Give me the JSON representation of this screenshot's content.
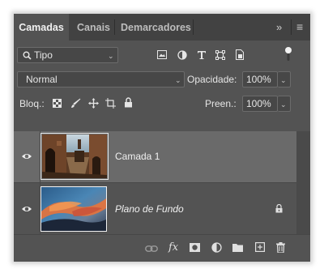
{
  "tabs": [
    {
      "label": "Camadas",
      "active": true
    },
    {
      "label": "Canais",
      "active": false
    },
    {
      "label": "Demarcadores",
      "active": false
    }
  ],
  "tab_bar_icons": {
    "collapse": "»",
    "menu": "≡"
  },
  "filter": {
    "kind_label": "Tipo",
    "filter_icons": [
      "image-filter-icon",
      "adjustment-filter-icon",
      "type-filter-icon",
      "shape-filter-icon",
      "smart-object-filter-icon"
    ],
    "toggle_icon": "filter-toggle-icon"
  },
  "blend": {
    "mode": "Normal",
    "opacity_label": "Opacidade:",
    "opacity_value": "100%"
  },
  "lock": {
    "label": "Bloq.:",
    "icons": [
      "lock-transparent-icon",
      "lock-image-icon",
      "lock-position-icon",
      "lock-artboard-icon",
      "lock-all-icon"
    ],
    "fill_label": "Preen.:",
    "fill_value": "100%"
  },
  "layers": [
    {
      "name": "Camada 1",
      "visible": true,
      "selected": true,
      "italic": false,
      "locked": false
    },
    {
      "name": "Plano de Fundo",
      "visible": true,
      "selected": false,
      "italic": true,
      "locked": true
    }
  ],
  "bottom_icons": [
    "link-layers-icon",
    "fx-icon",
    "mask-icon",
    "adjustment-layer-icon",
    "group-folder-icon",
    "new-layer-icon",
    "trash-icon"
  ],
  "colors": {
    "panel": "#535353",
    "tab_bar": "#424242",
    "selected_layer": "#6a6a6a"
  }
}
